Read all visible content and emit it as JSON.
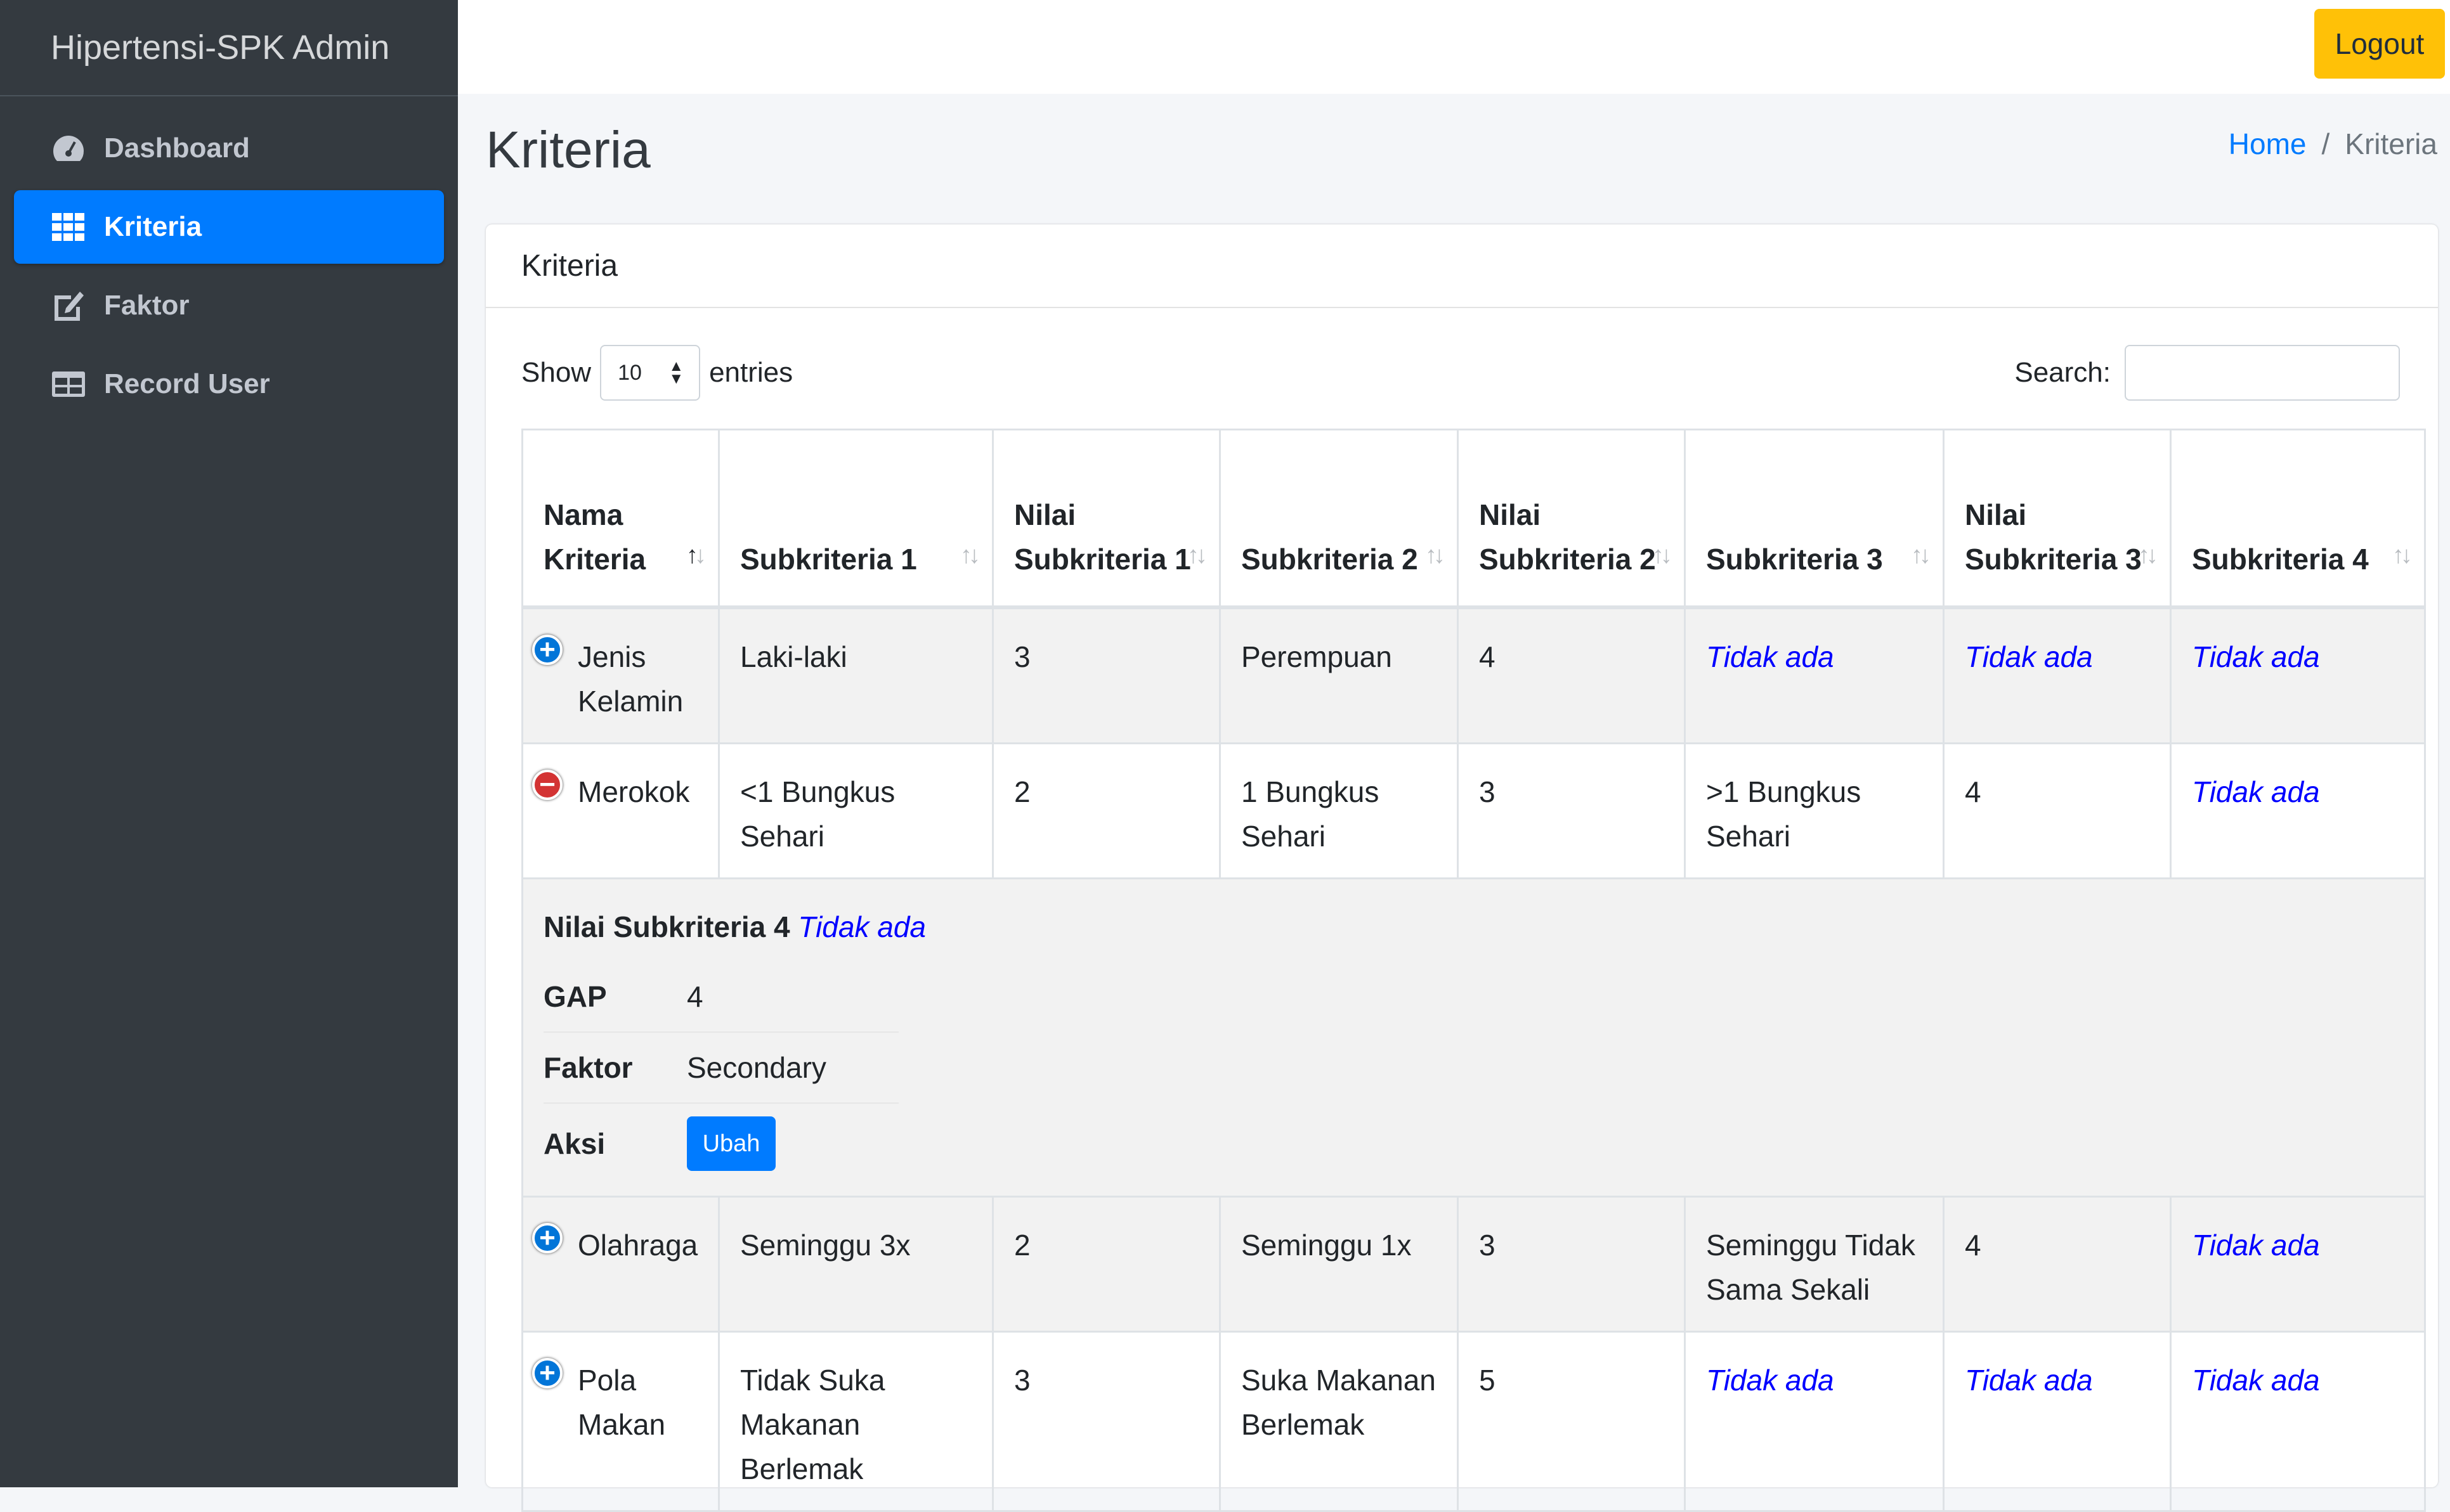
{
  "app": {
    "brand": "Hipertensi-SPK Admin"
  },
  "sidebar": {
    "items": [
      {
        "label": "Dashboard",
        "icon": "tachometer-icon",
        "active": false
      },
      {
        "label": "Kriteria",
        "icon": "grid-icon",
        "active": true
      },
      {
        "label": "Faktor",
        "icon": "edit-icon",
        "active": false
      },
      {
        "label": "Record User",
        "icon": "table-icon",
        "active": false
      }
    ]
  },
  "topbar": {
    "logout_label": "Logout"
  },
  "page": {
    "title": "Kriteria"
  },
  "breadcrumb": {
    "home": "Home",
    "separator": "/",
    "current": "Kriteria"
  },
  "card": {
    "title": "Kriteria",
    "length": {
      "show": "Show",
      "value": "10",
      "entries": "entries"
    },
    "search": {
      "label": "Search:",
      "value": ""
    }
  },
  "table": {
    "headers": [
      "Nama Kriteria",
      "Subkriteria 1",
      "Nilai Subkriteria 1",
      "Subkriteria 2",
      "Nilai Subkriteria 2",
      "Subkriteria 3",
      "Nilai Subkriteria 3",
      "Subkriteria 4"
    ],
    "sorted_column": "Nama Kriteria",
    "rows": [
      {
        "expanded": false,
        "cells": [
          "Jenis Kelamin",
          "Laki-laki",
          "3",
          "Perempuan",
          "4",
          "Tidak ada",
          "Tidak ada",
          "Tidak ada"
        ]
      },
      {
        "expanded": true,
        "cells": [
          "Merokok",
          "<1 Bungkus Sehari",
          "2",
          "1 Bungkus Sehari",
          "3",
          ">1 Bungkus Sehari",
          "4",
          "Tidak ada"
        ]
      },
      {
        "expanded": false,
        "cells": [
          "Olahraga",
          "Seminggu 3x",
          "2",
          "Seminggu 1x",
          "3",
          "Seminggu Tidak Sama Sekali",
          "4",
          "Tidak ada"
        ]
      },
      {
        "expanded": false,
        "cells": [
          "Pola Makan",
          "Tidak Suka Makanan Berlemak",
          "3",
          "Suka Makanan Berlemak",
          "5",
          "Tidak ada",
          "Tidak ada",
          "Tidak ada"
        ]
      }
    ],
    "child": {
      "nilai4_label": "Nilai Subkriteria 4",
      "nilai4_value": "Tidak ada",
      "gap_label": "GAP",
      "gap_value": "4",
      "faktor_label": "Faktor",
      "faktor_value": "Secondary",
      "aksi_label": "Aksi",
      "ubah_label": "Ubah"
    },
    "empty_value": "Tidak ada"
  },
  "colors": {
    "sidebar": "#343a40",
    "accent": "#007bff",
    "logout": "#ffc107",
    "minus": "#d33333",
    "na_text": "#0000ff"
  }
}
